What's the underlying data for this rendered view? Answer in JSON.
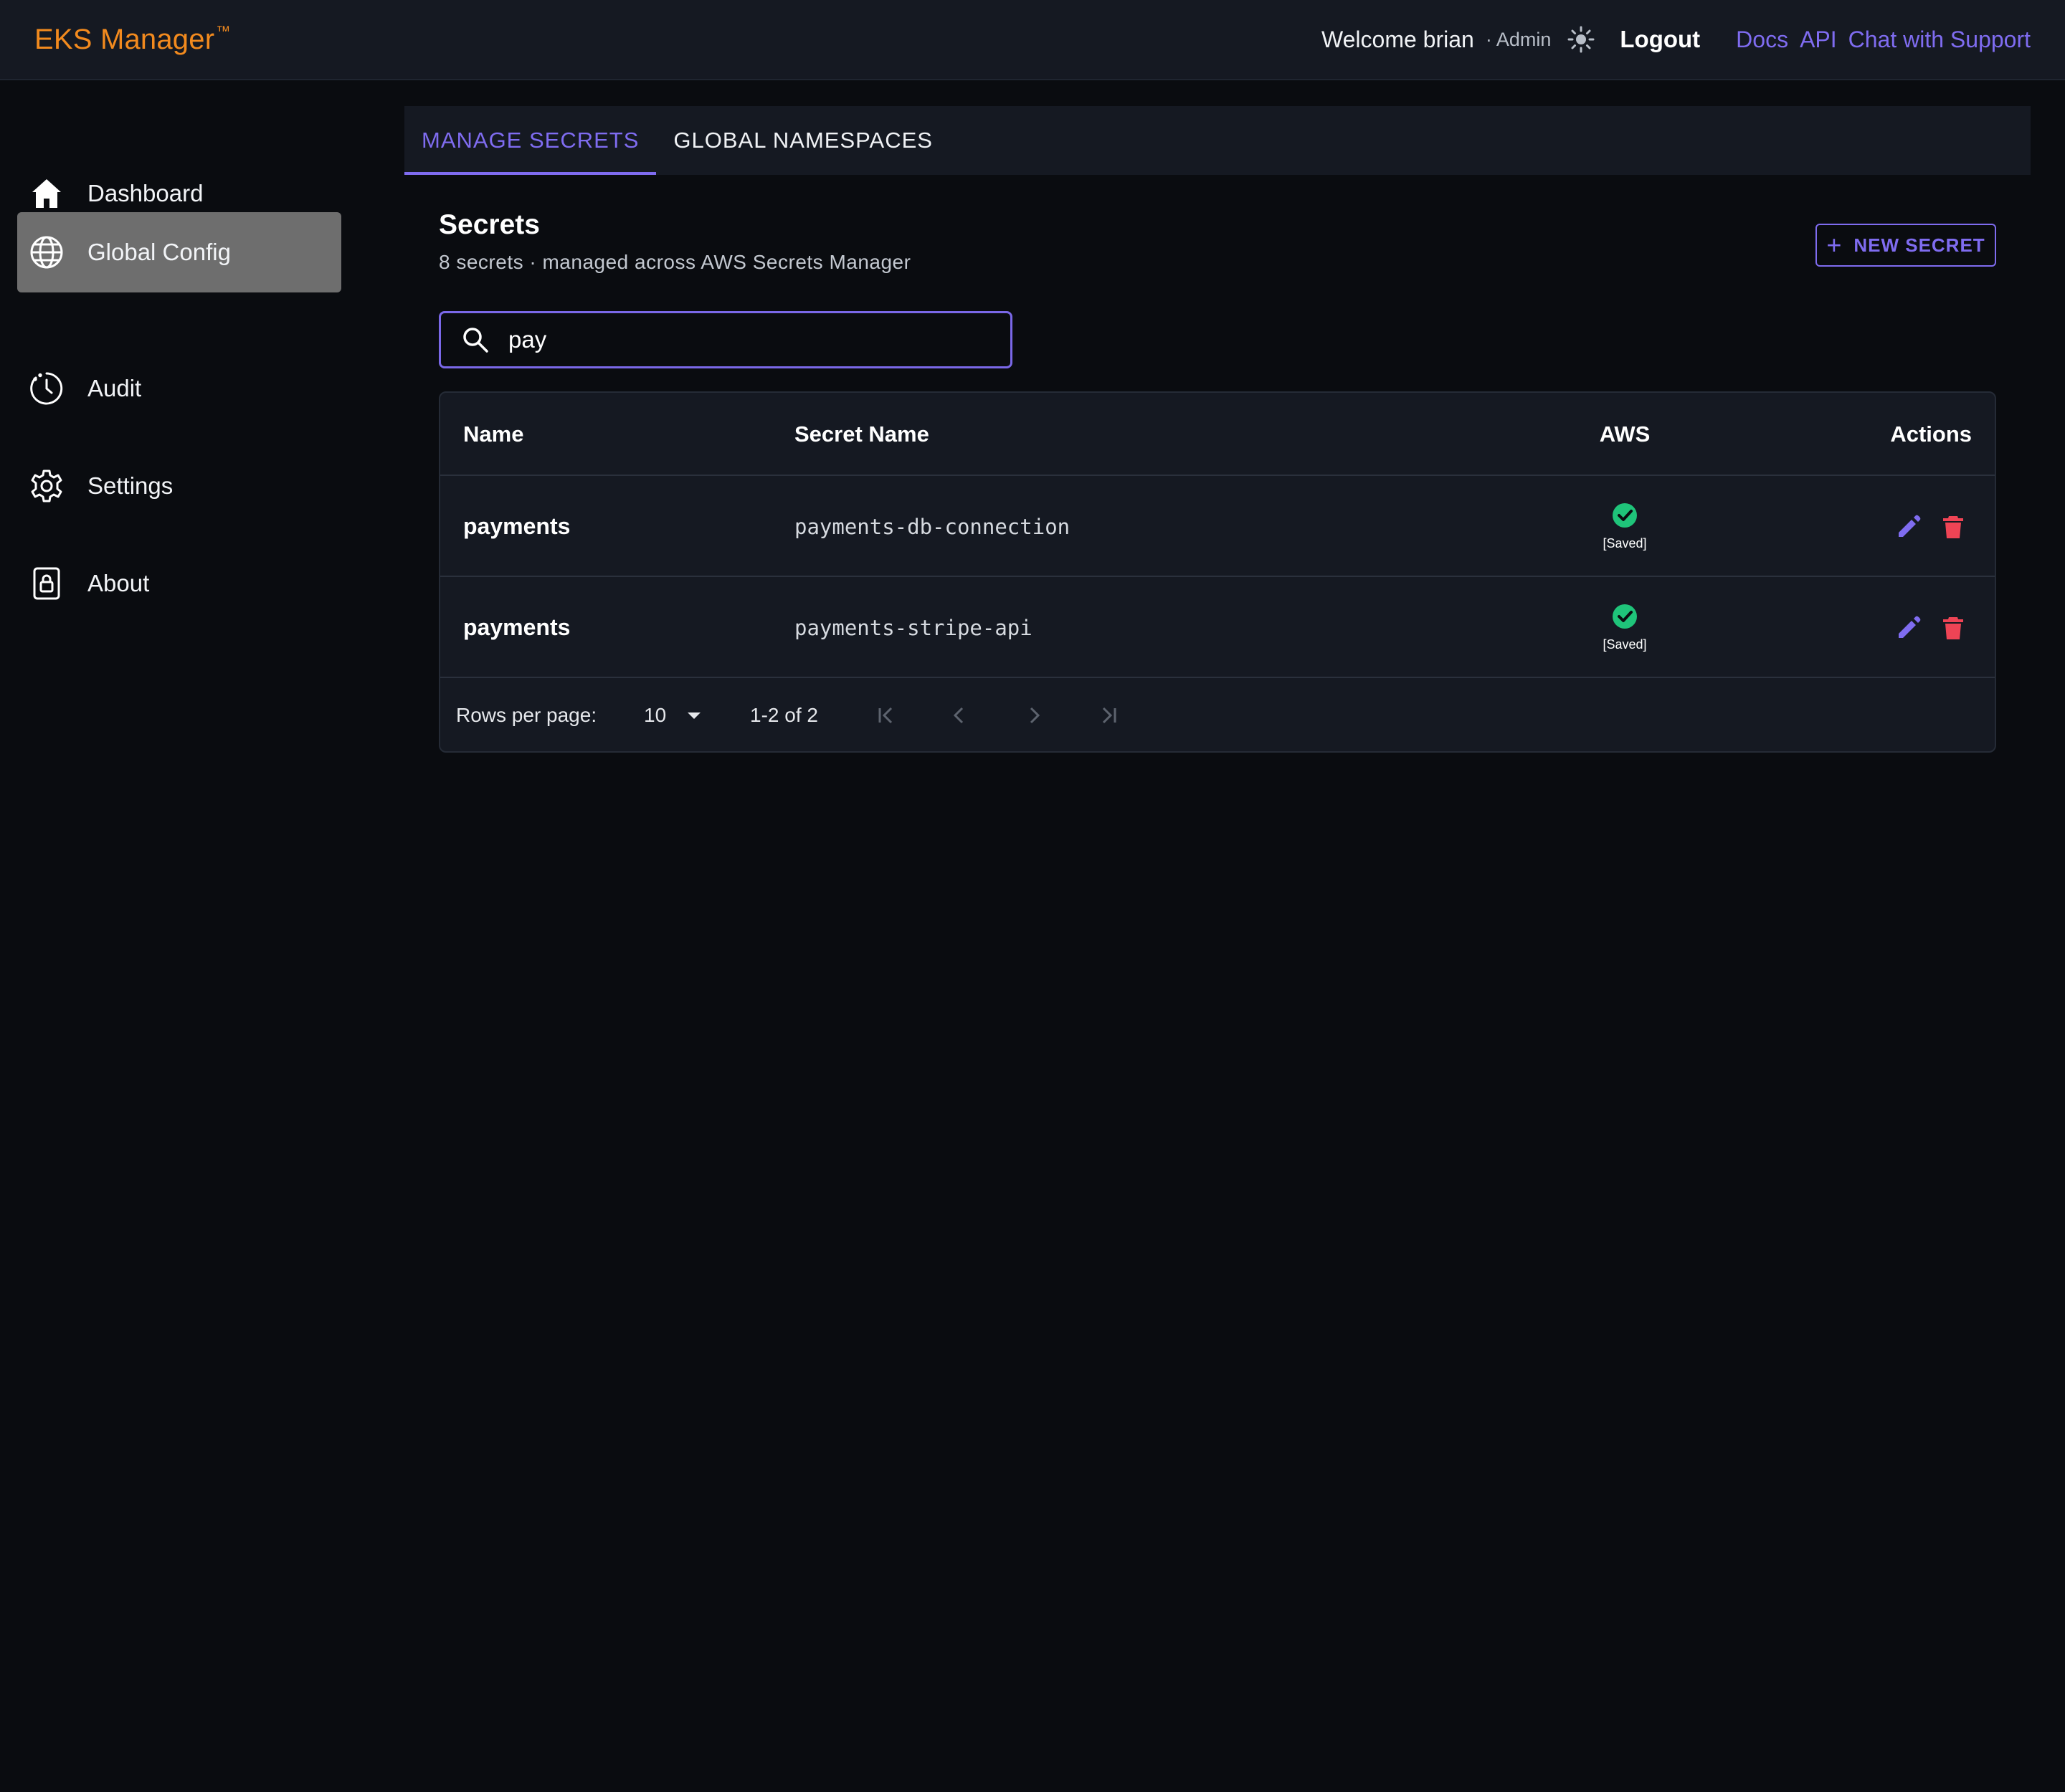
{
  "app": {
    "brand": "EKS Manager",
    "brand_mark": "™"
  },
  "header": {
    "welcome": "Welcome brian",
    "role": "· Admin",
    "theme_icon": "sun-icon",
    "logout": "Logout",
    "links": [
      "Docs",
      "API",
      "Chat with Support"
    ]
  },
  "sidebar": {
    "items": [
      {
        "label": "Dashboard",
        "icon": "home-icon",
        "active": false
      },
      {
        "label": "Global Config",
        "icon": "globe-icon",
        "active": true
      },
      {
        "label": "Audit",
        "icon": "clock-icon",
        "active": false
      },
      {
        "label": "Settings",
        "icon": "gear-icon",
        "active": false
      },
      {
        "label": "About",
        "icon": "lock-icon",
        "active": false
      }
    ]
  },
  "tabs": [
    {
      "label": "MANAGE SECRETS",
      "active": true
    },
    {
      "label": "GLOBAL NAMESPACES",
      "active": false
    }
  ],
  "section": {
    "title": "Secrets",
    "subtitle": "8 secrets · managed across AWS Secrets Manager",
    "new_button": "NEW SECRET"
  },
  "search": {
    "value": "pay",
    "placeholder": ""
  },
  "table": {
    "columns": [
      "Name",
      "Secret Name",
      "AWS",
      "Actions"
    ],
    "rows": [
      {
        "name": "payments",
        "secret_name": "payments-db-connection",
        "aws_status": "[Saved]"
      },
      {
        "name": "payments",
        "secret_name": "payments-stripe-api",
        "aws_status": "[Saved]"
      }
    ],
    "footer": {
      "rows_per_page_label": "Rows per page:",
      "rows_per_page_value": "10",
      "range": "1-2 of 2"
    }
  },
  "colors": {
    "accent": "#7f6cf0",
    "brand": "#f28a1e",
    "success": "#1fc47a",
    "danger": "#ef4455"
  }
}
